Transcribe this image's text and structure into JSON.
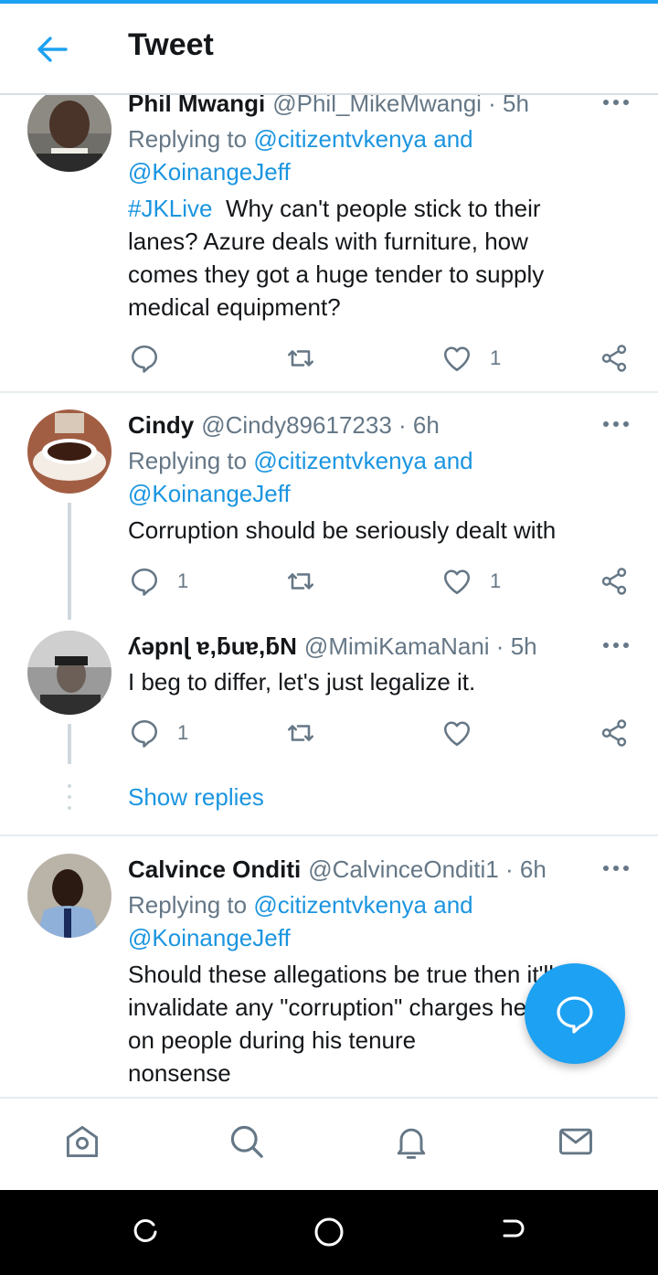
{
  "header": {
    "title": "Tweet"
  },
  "colors": {
    "accent": "#1da1f2",
    "link": "#1b95e0",
    "secondary_text": "#657786"
  },
  "tweets": [
    {
      "name": "Phil Mwangi",
      "handle": "@Phil_MikeMwangi",
      "time": "5h",
      "reply_prefix": "Replying to",
      "reply_to_1": "@citizentvkenya",
      "reply_and": "and",
      "reply_to_2": "@KoinangeJeff",
      "hashtag": "#JKLive",
      "text_1": "Why can't people stick to their",
      "text_2": "lanes? Azure deals with furniture, how",
      "text_3": "comes they got a huge tender to supply",
      "text_4": "medical equipment?",
      "replies": "",
      "likes": "1"
    },
    {
      "name": "Cindy",
      "handle": "@Cindy89617233",
      "time": "6h",
      "reply_prefix": "Replying to",
      "reply_to_1": "@citizentvkenya",
      "reply_and": "and",
      "reply_to_2": "@KoinangeJeff",
      "text_1": "Corruption should be seriously dealt with",
      "replies": "1",
      "likes": "1"
    },
    {
      "name": "ʎǝpnɭ ɐ,ƃuɐ,ƃN",
      "handle": "@MimiKamaNani",
      "time": "5h",
      "text_1": "I beg to differ, let's just legalize it.",
      "replies": "1",
      "likes": ""
    },
    {
      "name": "Calvince Onditi",
      "handle": "@CalvinceOnditi1",
      "time": "6h",
      "reply_prefix": "Replying to",
      "reply_to_1": "@citizentvkenya",
      "reply_and": "and",
      "reply_to_2": "@KoinangeJeff",
      "text_1": "Should these allegations be true then it'll",
      "text_2": "invalidate any \"corruption\" charges he put",
      "text_3": "on people during his tenure",
      "text_4": "nonsense"
    }
  ],
  "thread": {
    "show_replies": "Show replies"
  },
  "icons": {
    "back": "arrow-left-icon",
    "more": "more-horizontal-icon",
    "reply": "reply-icon",
    "retweet": "retweet-icon",
    "like": "heart-icon",
    "share": "share-icon",
    "compose": "compose-reply-icon",
    "home": "home-icon",
    "search": "search-icon",
    "notifications": "bell-icon",
    "messages": "mail-icon"
  }
}
